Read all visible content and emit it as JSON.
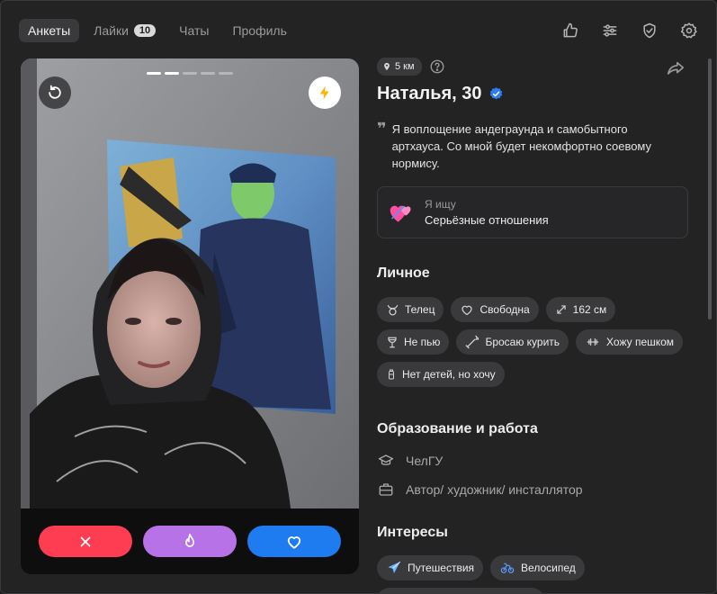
{
  "nav": {
    "tabs": [
      {
        "label": "Анкеты",
        "active": true
      },
      {
        "label": "Лайки",
        "badge": "10"
      },
      {
        "label": "Чаты"
      },
      {
        "label": "Профиль"
      }
    ],
    "icons": [
      "thumbs-up-icon",
      "filters-icon",
      "shield-check-icon",
      "settings-gear-icon"
    ]
  },
  "profile": {
    "distance": "5 км",
    "name": "Наталья, 30",
    "verified": true,
    "bio": "Я воплощение андеграунда и самобытного артхауса. Со мной будет некомфортно соевому нормису.",
    "seeking_label": "Я ищу",
    "seeking_value": "Серьёзные отношения",
    "photo_count": 5,
    "photo_index": 2
  },
  "personal": {
    "title": "Личное",
    "chips": [
      {
        "icon": "taurus-icon",
        "label": "Телец"
      },
      {
        "icon": "heart-outline-icon",
        "label": "Свободна"
      },
      {
        "icon": "height-icon",
        "label": "162 см"
      },
      {
        "icon": "wine-glass-icon",
        "label": "Не пью"
      },
      {
        "icon": "cigarette-icon",
        "label": "Бросаю курить"
      },
      {
        "icon": "dumbbell-icon",
        "label": "Хожу пешком"
      },
      {
        "icon": "baby-bottle-icon",
        "label": "Нет детей, но хочу"
      }
    ]
  },
  "education": {
    "title": "Образование и работа",
    "school": "ЧелГУ",
    "job": "Автор/ художник/ инсталлятор"
  },
  "interests": {
    "title": "Интересы",
    "chips": [
      {
        "icon": "airplane-icon",
        "label": "Путешествия"
      },
      {
        "icon": "bicycle-icon",
        "label": "Велосипед"
      }
    ]
  },
  "colors": {
    "dislike": "#ff3d52",
    "super": "#b872e8",
    "like": "#1e7bf0",
    "verified": "#2b7ef0",
    "boost": "#ffb400"
  }
}
